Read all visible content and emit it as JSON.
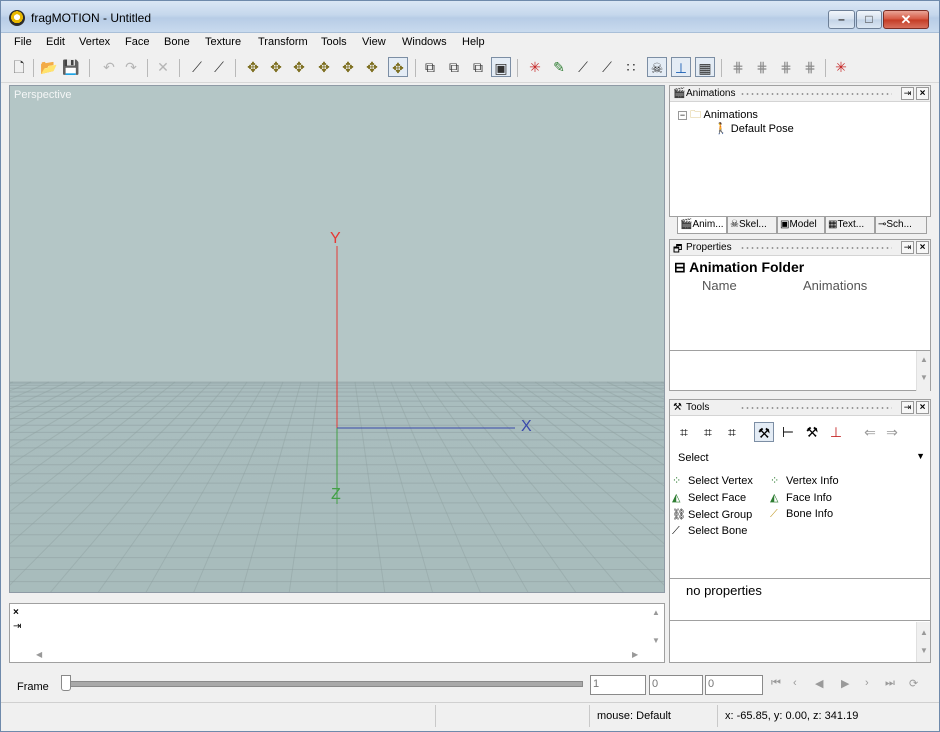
{
  "window": {
    "title": "fragMOTION - Untitled"
  },
  "menu": [
    "File",
    "Edit",
    "Vertex",
    "Face",
    "Bone",
    "Texture",
    "Transform",
    "Tools",
    "View",
    "Windows",
    "Help"
  ],
  "viewport": {
    "label": "Perspective",
    "axes": {
      "x": "X",
      "y": "Y",
      "z": "Z"
    }
  },
  "animations_panel": {
    "title": "Animations",
    "tree": [
      {
        "label": "Animations",
        "expanded": true
      },
      {
        "label": "Default Pose"
      }
    ]
  },
  "panel_tabs": [
    "Anim...",
    "Skel...",
    "Model",
    "Text...",
    "Sch..."
  ],
  "properties_panel": {
    "title": "Properties",
    "heading": "Animation Folder",
    "name_label": "Name",
    "name_value": "Animations"
  },
  "tools_panel": {
    "title": "Tools",
    "select": "Select",
    "items_left": [
      "Select Vertex",
      "Select Face",
      "Select Group",
      "Select Bone"
    ],
    "items_right": [
      "Vertex Info",
      "Face Info",
      "Bone Info"
    ],
    "properties_text": "no properties"
  },
  "frame_bar": {
    "label": "Frame",
    "field1": "1",
    "field2": "0",
    "field3": "0"
  },
  "status": {
    "mouse": "mouse: Default",
    "coords": "x: -65.85, y: 0.00, z: 341.19"
  }
}
